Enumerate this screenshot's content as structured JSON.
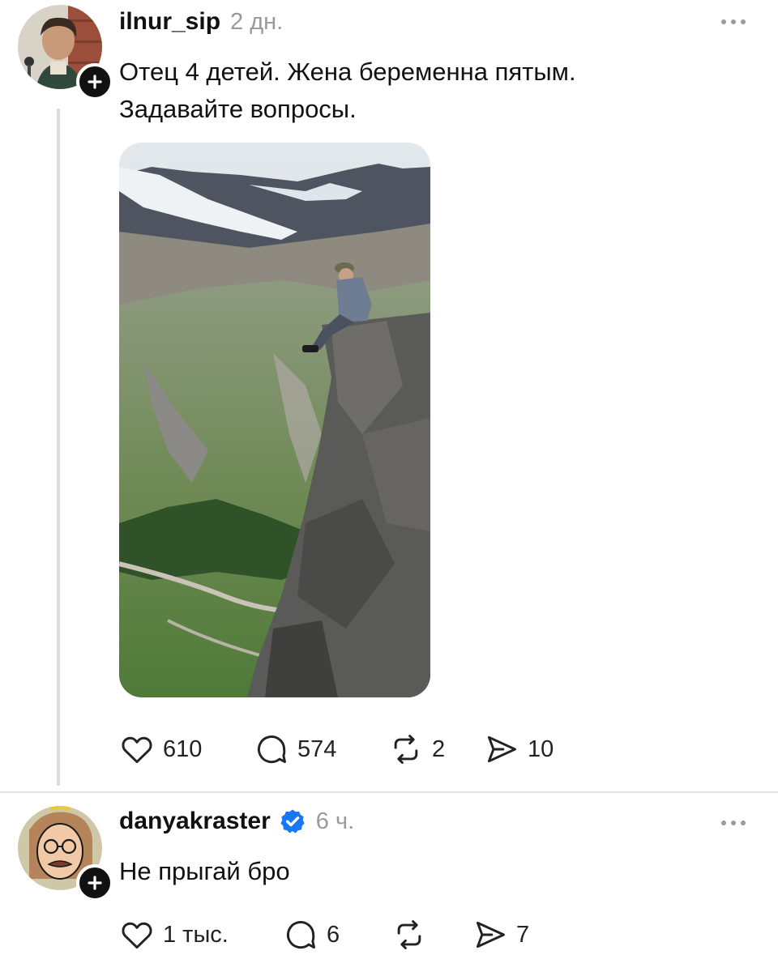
{
  "post": {
    "username": "ilnur_sip",
    "time": "2 дн.",
    "text_line1": "Отец 4 детей. Жена беременна пятым.",
    "text_line2": "Задавайте вопросы.",
    "likes": "610",
    "comments": "574",
    "reposts": "2",
    "shares": "10"
  },
  "reply": {
    "username": "danyakraster",
    "verified": true,
    "time": "6 ч.",
    "text": "Не прыгай бро",
    "likes": "1 тыс.",
    "comments": "6",
    "reposts": "",
    "shares": "7"
  },
  "icons": [
    "plus-icon",
    "more-icon",
    "heart-icon",
    "comment-icon",
    "repost-icon",
    "share-icon",
    "verified-icon"
  ],
  "colors": {
    "verified": "#1877F2",
    "muted": "#9a9a9a",
    "text": "#111111"
  }
}
